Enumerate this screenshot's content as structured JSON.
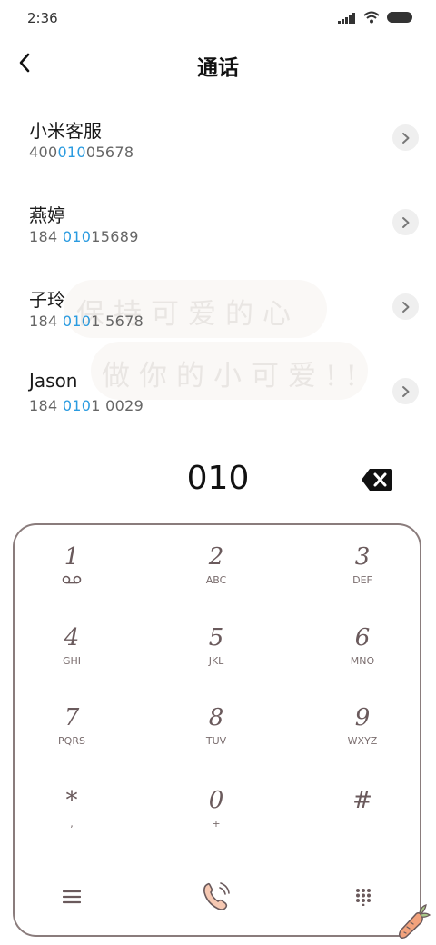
{
  "status": {
    "time": "2:36"
  },
  "header": {
    "title": "通话"
  },
  "contacts": [
    {
      "name": "小米客服",
      "pre": "400",
      "match": "010",
      "post": "05678"
    },
    {
      "name": "燕婷",
      "pre": "184 ",
      "match": "010",
      "post": "15689"
    },
    {
      "name": "子玲",
      "pre": "184 ",
      "match": "010",
      "post": "1 5678"
    },
    {
      "name": "Jason",
      "pre": "184 ",
      "match": "010",
      "post": "1 0029"
    }
  ],
  "watermark": {
    "line1": "保持可爱的心",
    "line2": "做你的小可爱!!"
  },
  "dialed": "010",
  "keys": [
    {
      "digit": "1",
      "letters": ""
    },
    {
      "digit": "2",
      "letters": "ABC"
    },
    {
      "digit": "3",
      "letters": "DEF"
    },
    {
      "digit": "4",
      "letters": "GHI"
    },
    {
      "digit": "5",
      "letters": "JKL"
    },
    {
      "digit": "6",
      "letters": "MNO"
    },
    {
      "digit": "7",
      "letters": "PQRS"
    },
    {
      "digit": "8",
      "letters": "TUV"
    },
    {
      "digit": "9",
      "letters": "WXYZ"
    },
    {
      "digit": "*",
      "letters": ","
    },
    {
      "digit": "0",
      "letters": "+"
    },
    {
      "digit": "#",
      "letters": ""
    }
  ],
  "icons": {
    "back": "chevron-left-icon",
    "backspace": "backspace-icon",
    "menu": "menu-icon",
    "call": "phone-icon",
    "keypad": "dialpad-icon",
    "voicemail": "voicemail-icon",
    "decor": "carrot-icon"
  },
  "colors": {
    "highlight": "#2a9be0",
    "keypad_border": "#8a7c7c",
    "call": "#e8a58a"
  }
}
